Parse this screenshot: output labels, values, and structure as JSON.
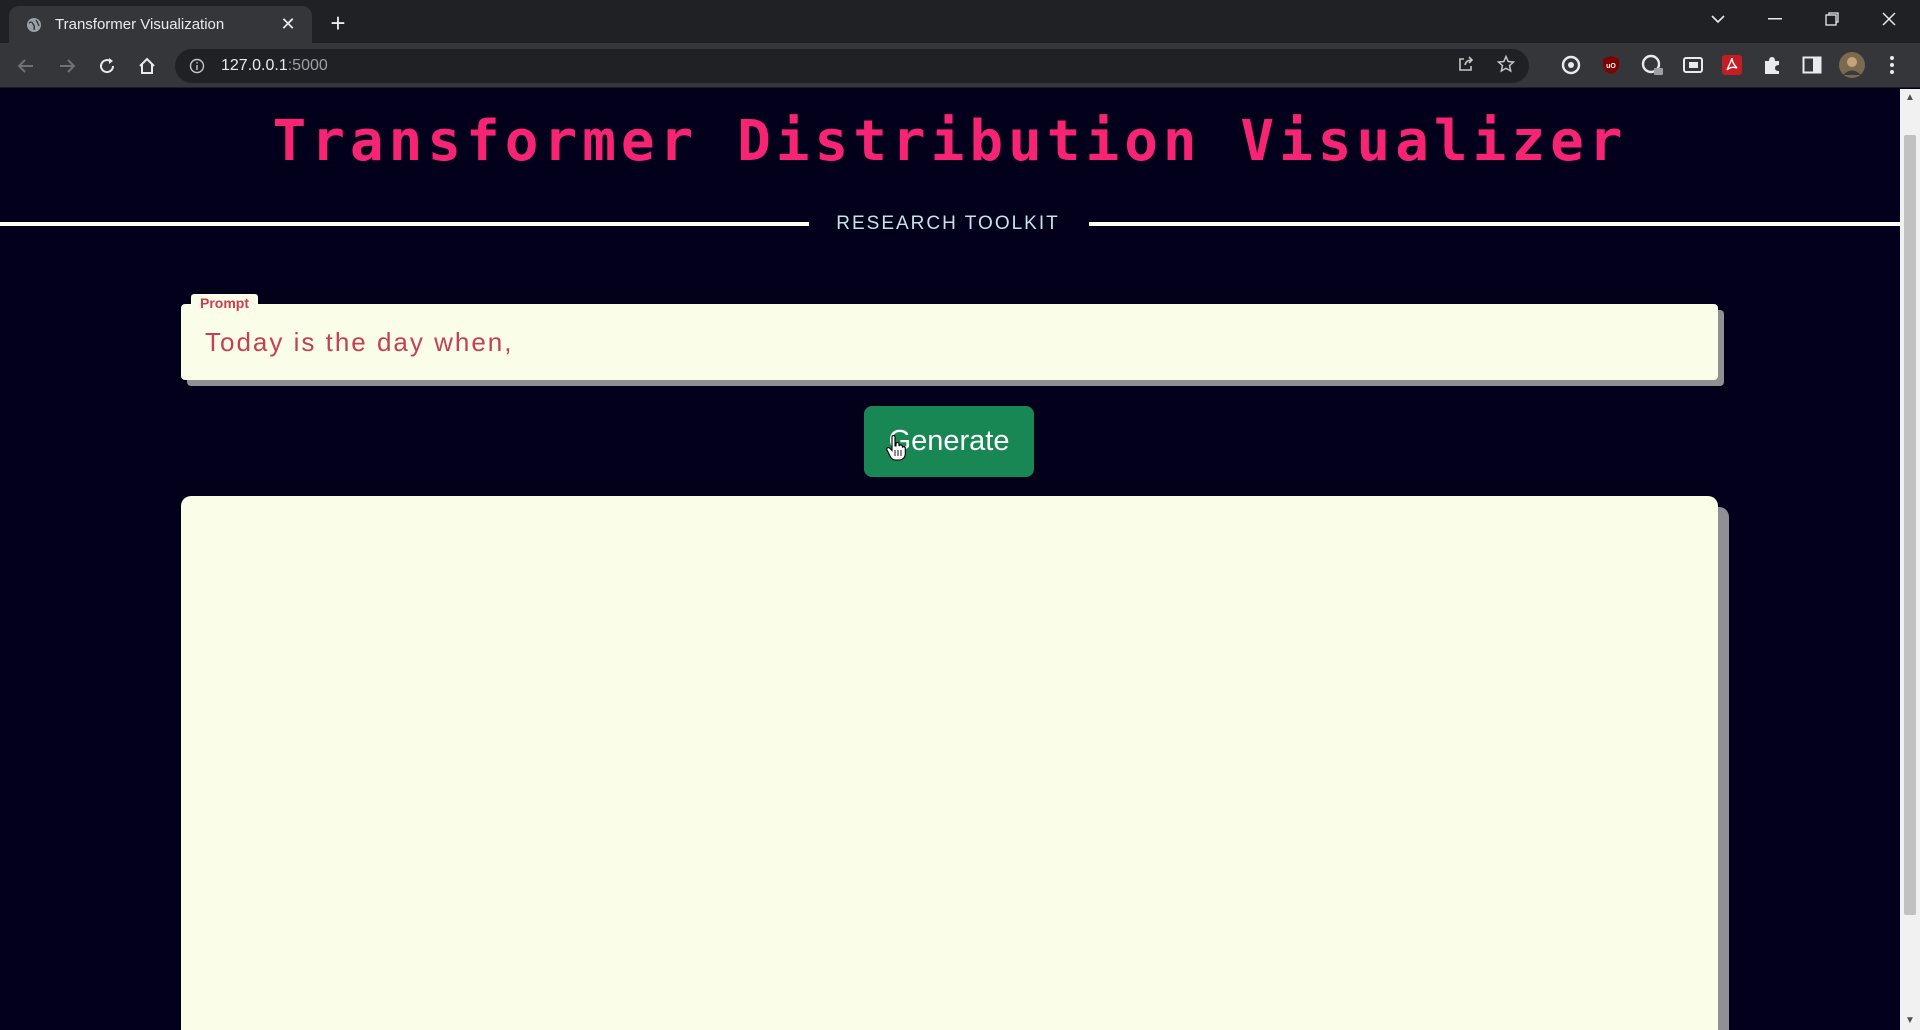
{
  "browser": {
    "tab_title": "Transformer Visualization",
    "url_host": "127.0.0.1",
    "url_port": ":5000"
  },
  "page": {
    "title": "Transformer Distribution Visualizer",
    "subtitle": "RESEARCH TOOLKIT",
    "prompt_label": "Prompt",
    "prompt_value": "Today is the day when,",
    "generate_label": "Generate"
  },
  "colors": {
    "background": "#03001c",
    "title": "#f72474",
    "panel": "#fafde8",
    "button": "#198754",
    "prompt_text": "#c53f56"
  },
  "icons": {
    "tab": "globe-icon",
    "toolbar": [
      "back-arrow-icon",
      "forward-arrow-icon",
      "reload-icon",
      "home-icon",
      "site-info-icon",
      "share-icon",
      "bookmark-star-icon"
    ],
    "extensions": [
      "extension-circle-icon",
      "ublock-icon",
      "extension-ring-icon",
      "picture-in-picture-icon",
      "pdf-icon",
      "puzzle-extensions-icon",
      "side-panel-icon",
      "profile-avatar",
      "kebab-menu-icon"
    ]
  }
}
